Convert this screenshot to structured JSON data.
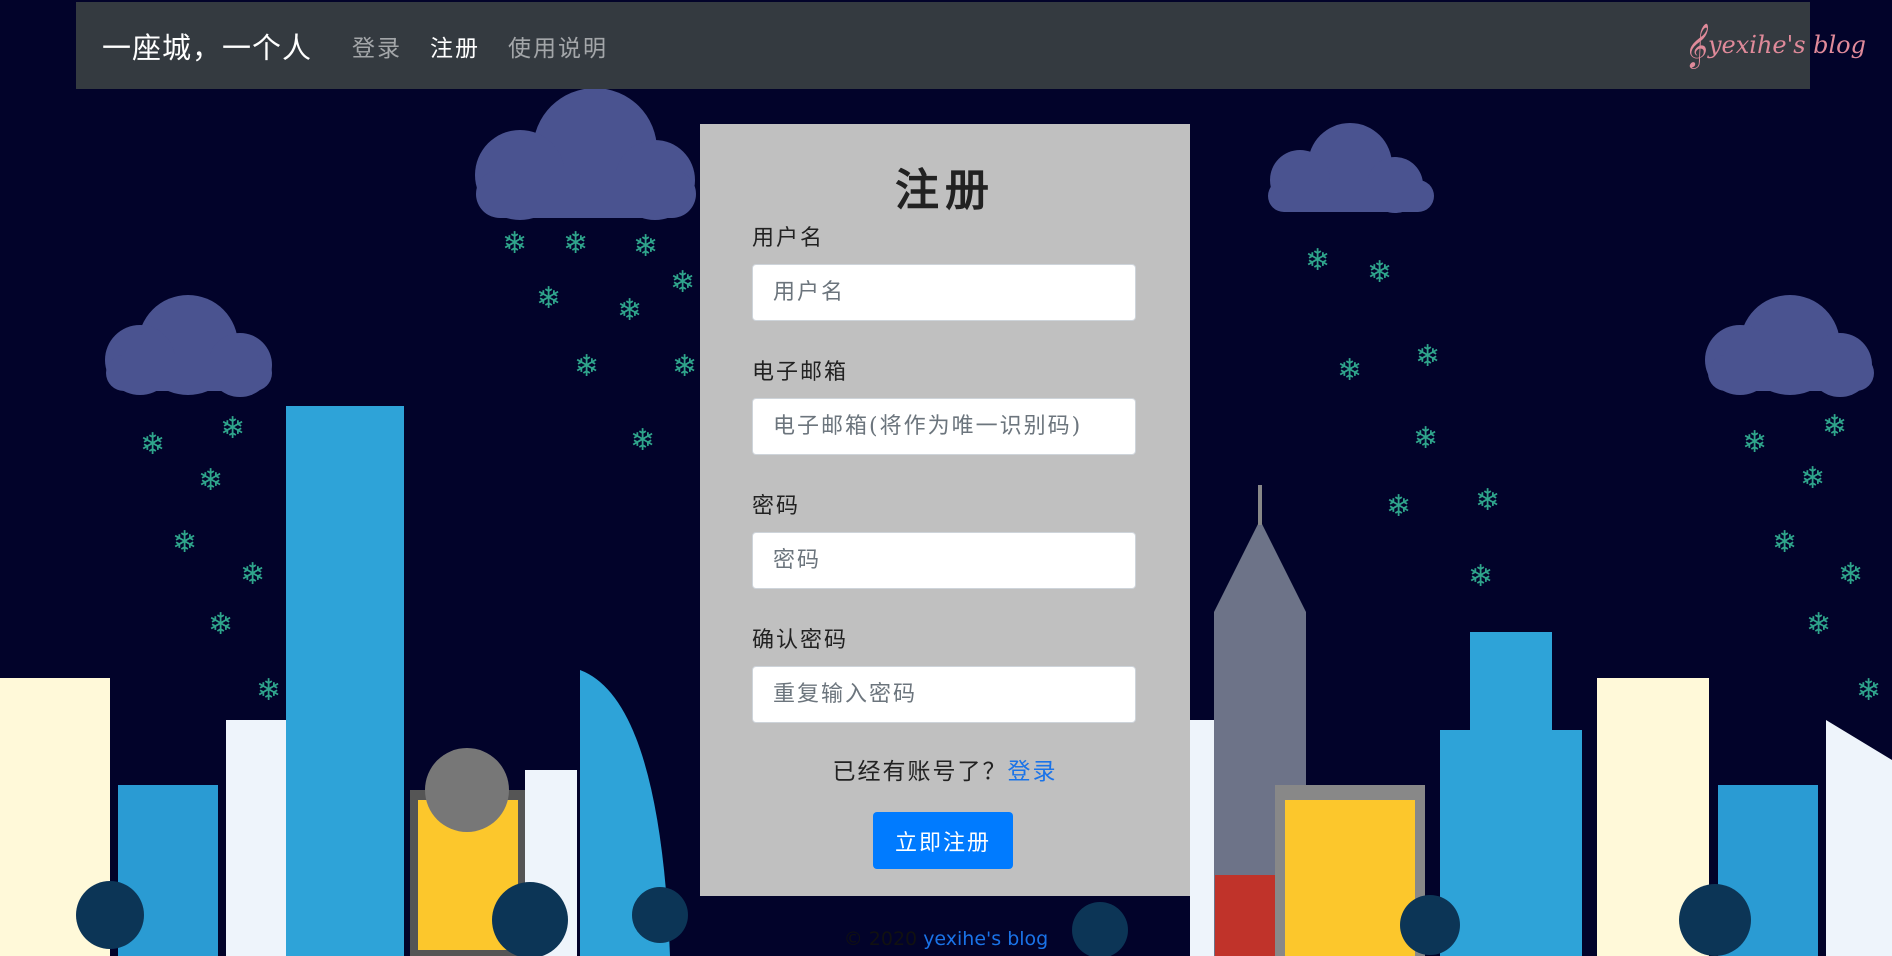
{
  "navbar": {
    "brand": "一座城，一个人",
    "links": [
      {
        "label": "登录",
        "active": false
      },
      {
        "label": "注册",
        "active": true
      },
      {
        "label": "使用说明",
        "active": false
      }
    ],
    "logo_text": "yexihe's blog"
  },
  "form": {
    "title": "注册",
    "fields": [
      {
        "label": "用户名",
        "placeholder": "用户名",
        "type": "text"
      },
      {
        "label": "电子邮箱",
        "placeholder": "电子邮箱(将作为唯一识别码)",
        "type": "email"
      },
      {
        "label": "密码",
        "placeholder": "密码",
        "type": "password"
      },
      {
        "label": "确认密码",
        "placeholder": "重复输入密码",
        "type": "password"
      }
    ],
    "switch_text": "已经有账号了？",
    "switch_link": "登录",
    "submit_label": "立即注册"
  },
  "footer": {
    "copyright": "© 2020 ",
    "link": "yexihe's blog"
  },
  "colors": {
    "navbar_bg": "#343a40",
    "card_bg": "#c0c0c0",
    "primary": "#007bff",
    "page_bg": "#02032a"
  }
}
